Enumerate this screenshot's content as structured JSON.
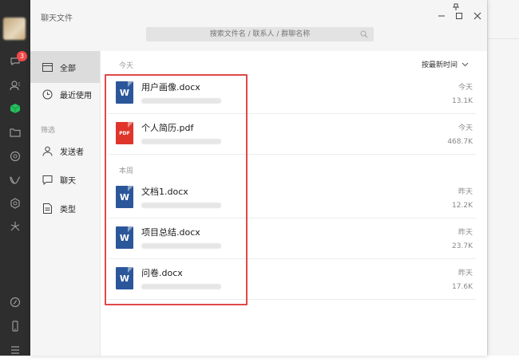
{
  "window": {
    "title": "聊天文件",
    "pin": "pin-icon",
    "minimize": "minimize-icon",
    "maximize": "maximize-icon",
    "close": "close-icon"
  },
  "search": {
    "placeholder": "搜索文件名 / 联系人 / 群聊名称",
    "icon": "search-icon"
  },
  "navbar": {
    "unread_count": "3",
    "icons": [
      "chat-icon",
      "contacts-icon",
      "favorites-icon",
      "folder-icon",
      "moments-icon",
      "channels-icon",
      "search-nav-icon",
      "miniprogram-icon",
      "miniprogram-bottom-icon",
      "phone-icon",
      "menu-icon"
    ]
  },
  "sidebar": {
    "items": [
      {
        "label": "全部",
        "icon": "folder-icon",
        "active": true
      },
      {
        "label": "最近使用",
        "icon": "clock-icon",
        "active": false
      }
    ],
    "filter_heading": "筛选",
    "filters": [
      {
        "label": "发送者",
        "icon": "person-icon"
      },
      {
        "label": "聊天",
        "icon": "chat-bubble-icon"
      },
      {
        "label": "类型",
        "icon": "document-icon"
      }
    ]
  },
  "list": {
    "sort_label": "按最新时间",
    "sections": [
      {
        "heading": "今天",
        "files": [
          {
            "name": "用户画像.docx",
            "type": "word",
            "type_label": "W",
            "date": "今天",
            "size": "13.1K"
          },
          {
            "name": "个人简历.pdf",
            "type": "pdf",
            "type_label": "PDF",
            "date": "今天",
            "size": "468.7K"
          }
        ]
      },
      {
        "heading": "本周",
        "files": [
          {
            "name": "文档1.docx",
            "type": "word",
            "type_label": "W",
            "date": "昨天",
            "size": "12.2K"
          },
          {
            "name": "项目总结.docx",
            "type": "word",
            "type_label": "W",
            "date": "昨天",
            "size": "23.7K"
          },
          {
            "name": "问卷.docx",
            "type": "word",
            "type_label": "W",
            "date": "昨天",
            "size": "17.6K"
          }
        ]
      }
    ]
  },
  "colors": {
    "word": "#2b579a",
    "pdf": "#e0352b",
    "highlight": "#e04848",
    "badge": "#f5484a",
    "navbar": "#2e2e2e"
  }
}
